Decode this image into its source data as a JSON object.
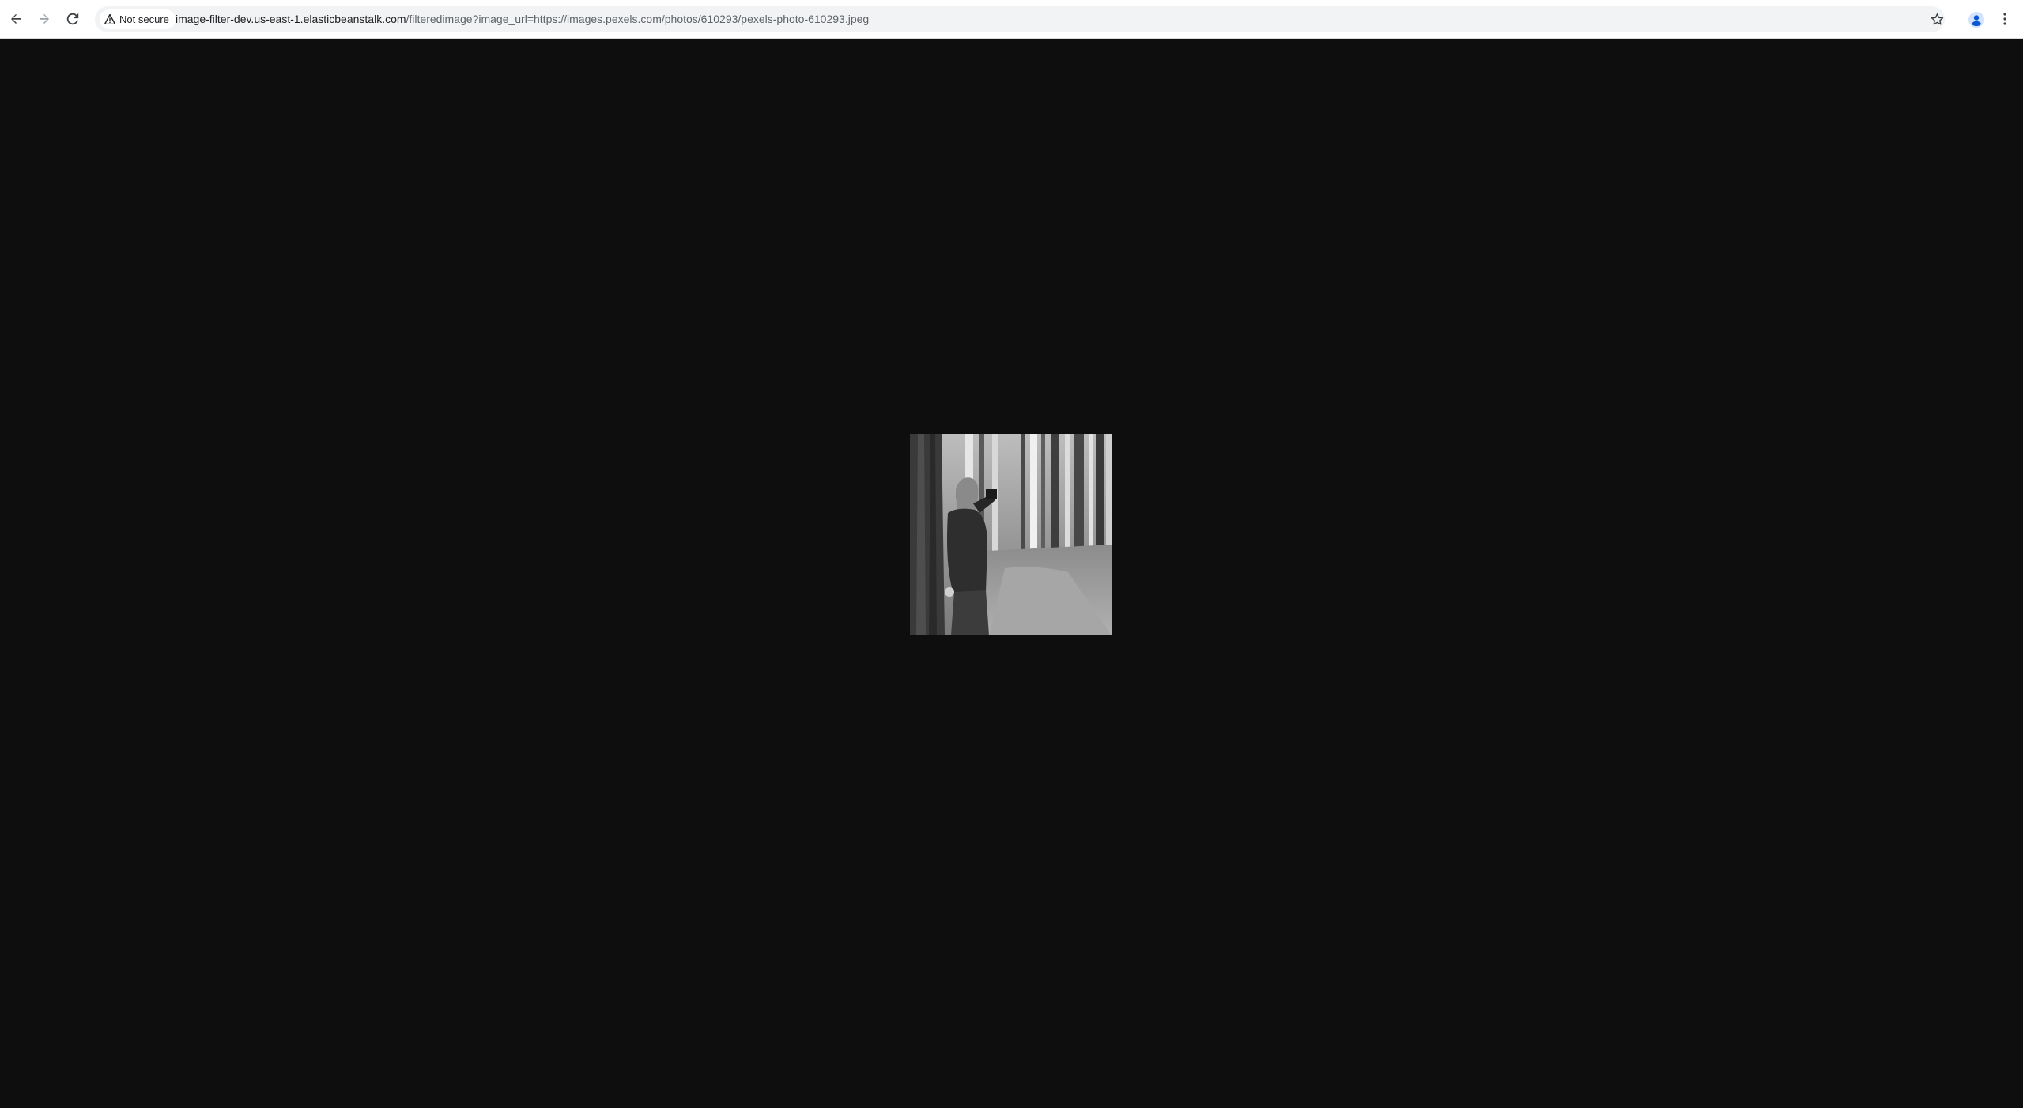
{
  "browser": {
    "security_label": "Not secure",
    "url_host": "image-filter-dev.us-east-1.elasticbeanstalk.com",
    "url_path": "/filteredimage?image_url=https://images.pexels.com/photos/610293/pexels-photo-610293.jpeg",
    "icons": {
      "back": "back-arrow-icon",
      "forward": "forward-arrow-icon",
      "reload": "reload-icon",
      "warning": "warning-icon",
      "bookmark": "star-icon",
      "profile": "profile-icon",
      "menu": "kebab-menu-icon"
    }
  },
  "page": {
    "background_color": "#0e0e0e",
    "image": {
      "description_icon": "grayscale-photo",
      "tone": "grayscale"
    }
  }
}
